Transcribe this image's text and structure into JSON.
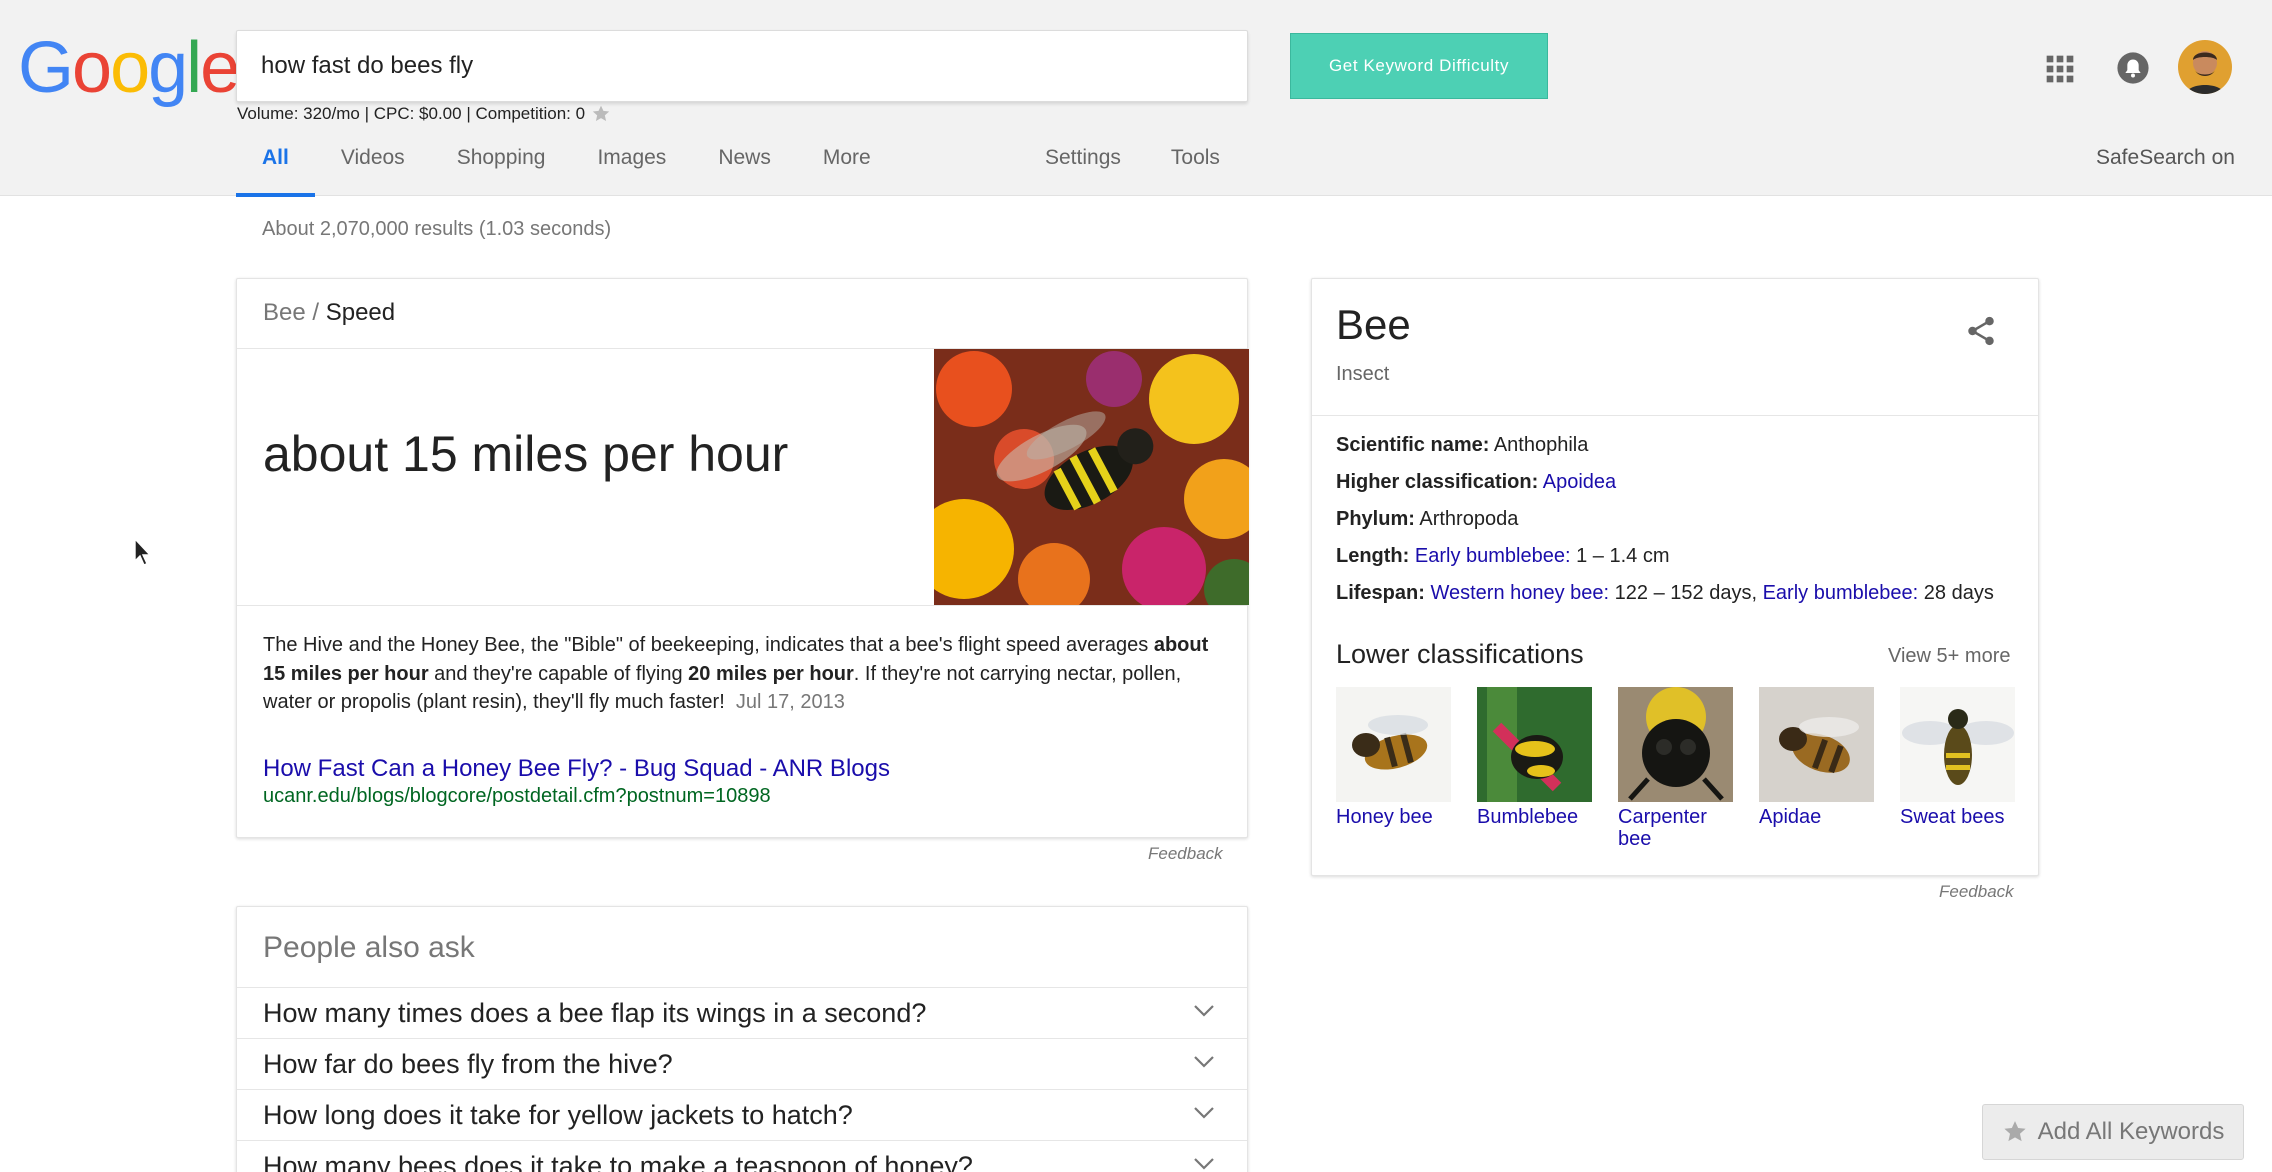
{
  "colors": {
    "accent": "#1a73e8",
    "link": "#1a0dab",
    "url_green": "#006621",
    "keyword_button": "#4dd0b4",
    "logo_blue": "#4285f4",
    "logo_red": "#ea4335",
    "logo_yellow": "#fbbc05",
    "logo_green": "#34a853"
  },
  "logo": {
    "letters": [
      "G",
      "o",
      "o",
      "g",
      "l",
      "e"
    ]
  },
  "search": {
    "query": "how fast do bees fly"
  },
  "keyword_button": {
    "label": "Get Keyword Difficulty"
  },
  "metrics": {
    "text": "Volume: 320/mo | CPC: $0.00 | Competition: 0"
  },
  "tabs": [
    {
      "label": "All",
      "active": true
    },
    {
      "label": "Videos"
    },
    {
      "label": "Shopping"
    },
    {
      "label": "Images"
    },
    {
      "label": "News"
    },
    {
      "label": "More"
    }
  ],
  "tools": [
    {
      "label": "Settings"
    },
    {
      "label": "Tools"
    }
  ],
  "safesearch": "SafeSearch on",
  "results_count": "About 2,070,000 results (1.03 seconds)",
  "snippet": {
    "breadcrumb_parent": "Bee",
    "breadcrumb_sep": "/",
    "breadcrumb_current": "Speed",
    "answer": "about 15 miles per hour",
    "text_1": "The Hive and the Honey Bee, the \"Bible\" of beekeeping, indicates that a bee's flight speed averages ",
    "bold_1": "about 15 miles per hour",
    "text_2": " and they're capable of flying ",
    "bold_2": "20 miles per hour",
    "text_3": ". If they're not carrying nectar, pollen, water or propolis (plant resin), they'll fly much faster!",
    "date": "Jul 17, 2013",
    "link_title": "How Fast Can a Honey Bee Fly? - Bug Squad - ANR Blogs",
    "url": "ucanr.edu/blogs/blogcore/postdetail.cfm?postnum=10898",
    "feedback": "Feedback"
  },
  "people_also_ask": {
    "title": "People also ask",
    "questions": [
      "How many times does a bee flap its wings in a second?",
      "How far do bees fly from the hive?",
      "How long does it take for yellow jackets to hatch?",
      "How many bees does it take to make a teaspoon of honey?"
    ]
  },
  "knowledge_panel": {
    "title": "Bee",
    "subtitle": "Insect",
    "facts": {
      "scientific_label": "Scientific name:",
      "scientific_value": "Anthophila",
      "higher_label": "Higher classification:",
      "higher_link": "Apoidea",
      "phylum_label": "Phylum:",
      "phylum_value": "Arthropoda",
      "length_label": "Length:",
      "length_link": "Early bumblebee:",
      "length_value": "1 – 1.4 cm",
      "lifespan_label": "Lifespan:",
      "lifespan_link1": "Western honey bee:",
      "lifespan_value1": "122 – 152 days,",
      "lifespan_link2": "Early bumblebee:",
      "lifespan_value2": "28 days"
    },
    "lower_title": "Lower classifications",
    "view_more": "View 5+ more",
    "lower_items": [
      "Honey bee",
      "Bumblebee",
      "Carpenter bee",
      "Apidae",
      "Sweat bees"
    ],
    "feedback": "Feedback"
  },
  "add_keywords": {
    "label": "Add All Keywords"
  },
  "icons": [
    "mic-icon",
    "search-icon",
    "star-icon",
    "apps-icon",
    "bell-icon",
    "share-icon",
    "chevron-down-icon",
    "cursor-icon"
  ]
}
